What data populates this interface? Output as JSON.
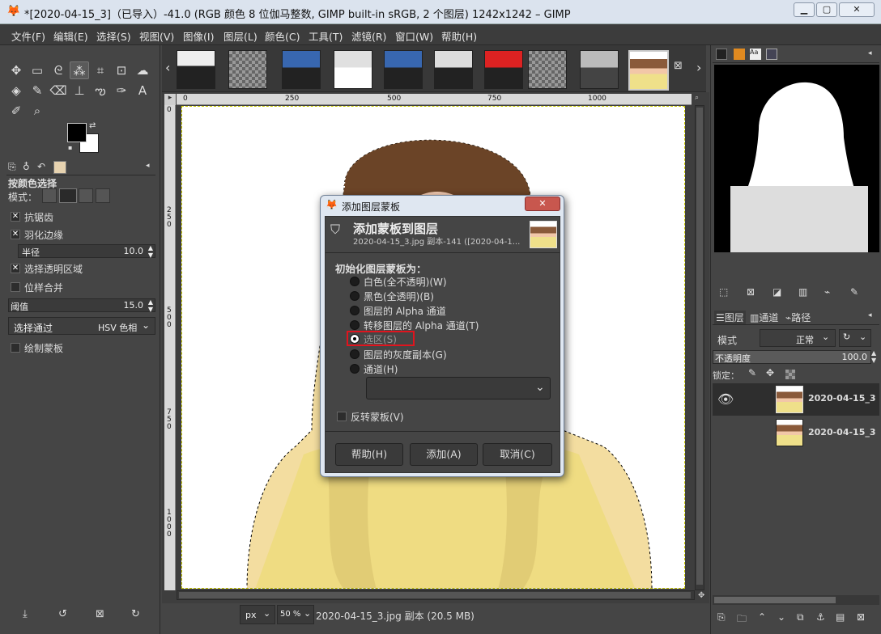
{
  "window": {
    "title": "*[2020-04-15_3]（已导入）-41.0 (RGB 颜色 8 位伽马整数, GIMP built-in sRGB, 2 个图层) 1242x1242 – GIMP",
    "min": "▁",
    "max": "▢",
    "close": "✕"
  },
  "menu": [
    "文件(F)",
    "编辑(E)",
    "选择(S)",
    "视图(V)",
    "图像(I)",
    "图层(L)",
    "颜色(C)",
    "工具(T)",
    "滤镜(R)",
    "窗口(W)",
    "帮助(H)"
  ],
  "tool_options": {
    "title": "按颜色选择",
    "mode_label": "模式：",
    "antialias": "抗锯齿",
    "feather": "羽化边缘",
    "radius_label": "半径",
    "radius_value": "10.0",
    "select_transparent": "选择透明区域",
    "sample_merged": "位样合并",
    "threshold_label": "阈值",
    "threshold_value": "15.0",
    "select_by_label": "选择通过",
    "select_by_value": "HSV 色相",
    "draw_mask": "绘制蒙板"
  },
  "ruler": {
    "h": [
      "0",
      "250",
      "500",
      "750",
      "1000"
    ],
    "v": [
      "0",
      "2\n5\n0",
      "5\n0\n0",
      "7\n5\n0",
      "1\n0\n0\n0"
    ]
  },
  "status": {
    "unit": "px",
    "zoom": "50 %",
    "info": "2020-04-15_3.jpg 副本 (20.5 MB)"
  },
  "dialog": {
    "title": "添加图层蒙板",
    "header": "添加蒙板到图层",
    "subheader": "2020-04-15_3.jpg 副本-141 ([2020-04-1...",
    "section": "初始化图层蒙板为：",
    "options": [
      "白色(全不透明)(W)",
      "黑色(全透明)(B)",
      "图层的 Alpha 通道",
      "转移图层的 Alpha 通道(T)",
      "选区(S)",
      "图层的灰度副本(G)",
      "通道(H)"
    ],
    "invert": "反转蒙板(V)",
    "help": "帮助(H)",
    "add": "添加(A)",
    "cancel": "取消(C)",
    "highlight_color": "#e0141e"
  },
  "layers_panel": {
    "tabs": [
      "图层",
      "通道",
      "路径"
    ],
    "mode_label": "模式",
    "mode_value": "正常",
    "opacity_label": "不透明度",
    "opacity_value": "100.0",
    "lock_label": "锁定：",
    "layers": [
      "2020-04-15_3",
      "2020-04-15_3"
    ]
  }
}
